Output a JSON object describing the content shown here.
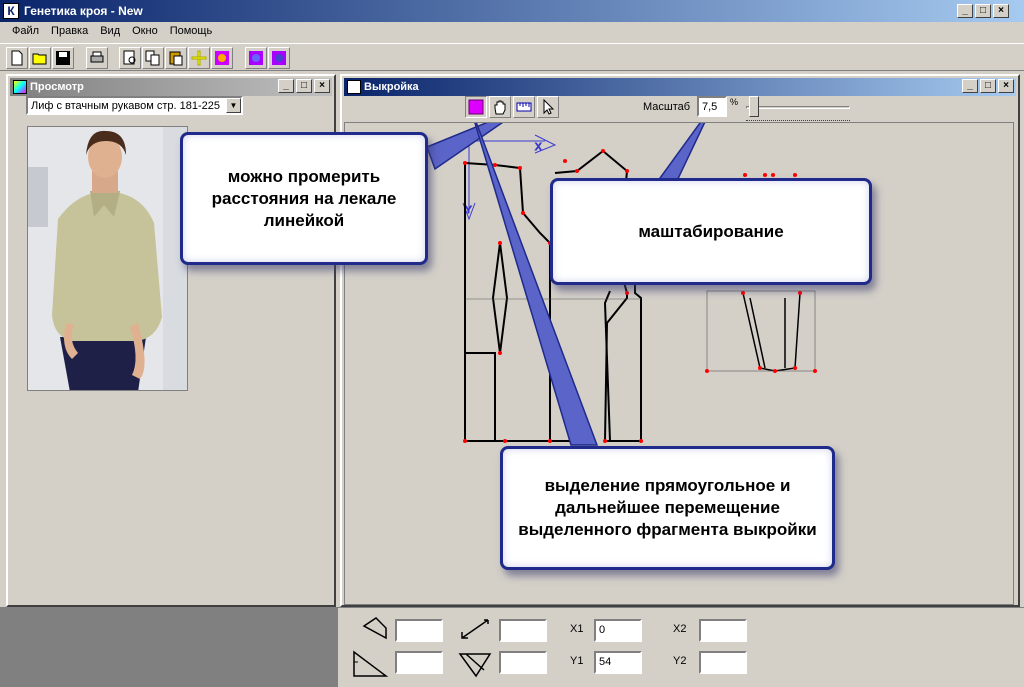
{
  "app": {
    "title": "Генетика кроя - New",
    "icon_letter": "К"
  },
  "menu": [
    "Файл",
    "Правка",
    "Вид",
    "Окно",
    "Помощь"
  ],
  "toolbar": {
    "icons": [
      "new-file-icon",
      "open-folder-icon",
      "save-icon",
      "print-icon",
      "print-preview-icon",
      "copy-icon",
      "paste-icon",
      "add-cross-icon",
      "color-image-icon",
      "image-tool-icon-1",
      "image-tool-icon-2"
    ]
  },
  "preview": {
    "title": "Просмотр",
    "selected_model": "Лиф с втачным рукавом стр. 181-225"
  },
  "pattern": {
    "title": "Выкройка",
    "scale_label": "Масштаб",
    "scale_value": "7,5",
    "scale_unit": "%",
    "scale_slider_fraction": 0.05,
    "tools": [
      "rect-select-icon",
      "hand-pan-icon",
      "ruler-icon",
      "pointer-arrow-icon"
    ]
  },
  "callouts": {
    "ruler": "можно промерить расстояния на лекале линейкой",
    "scale": "маштабирование",
    "select": "выделение прямоугольное и дальнейшее перемещение выделенного фрагмента выкройки"
  },
  "coords": {
    "x1_label": "X1",
    "x1_value": "0",
    "y1_label": "Y1",
    "y1_value": "54",
    "x2_label": "X2",
    "x2_value": "",
    "y2_label": "Y2",
    "y2_value": ""
  },
  "colors": {
    "title_active": "#0a246a",
    "callout_border": "#1f2a8a",
    "pattern_point": "#ff0000"
  }
}
